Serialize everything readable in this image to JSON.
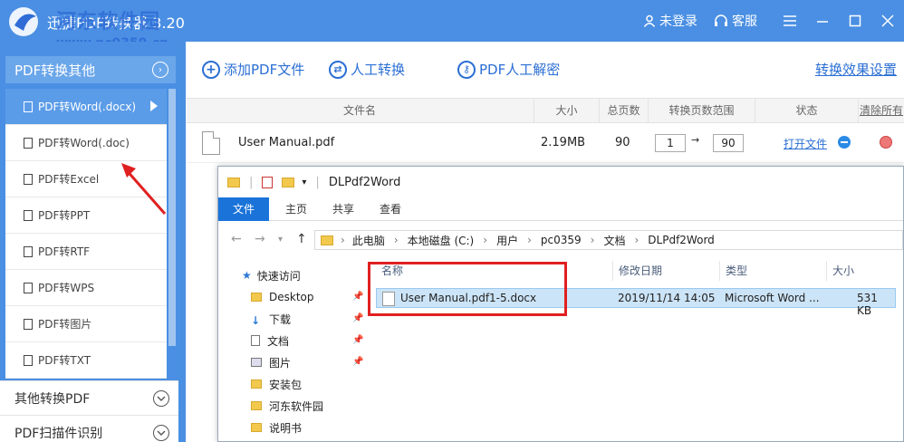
{
  "titlebar": {
    "app_title": "迅捷PDF转换器 3.20",
    "watermark_title": "河东软件园",
    "watermark_url": "www.pc0359.cn",
    "login": "未登录",
    "service": "客服"
  },
  "sidebar": {
    "section_title": "PDF转换其他",
    "items": [
      {
        "label": "PDF转Word(.docx)"
      },
      {
        "label": "PDF转Word(.doc)"
      },
      {
        "label": "PDF转Excel"
      },
      {
        "label": "PDF转PPT"
      },
      {
        "label": "PDF转RTF"
      },
      {
        "label": "PDF转WPS"
      },
      {
        "label": "PDF转图片"
      },
      {
        "label": "PDF转TXT"
      }
    ],
    "other_section": "其他转换PDF",
    "scan_section": "PDF扫描件识别"
  },
  "toolbar": {
    "add_pdf": "添加PDF文件",
    "manual_convert": "人工转换",
    "pdf_decrypt": "PDF人工解密",
    "settings": "转换效果设置"
  },
  "table": {
    "headers": [
      "文件名",
      "大小",
      "总页数",
      "转换页数范围",
      "状态",
      "清除所有"
    ],
    "row": {
      "name": "User Manual.pdf",
      "size": "2.19MB",
      "pages": "90",
      "range_from": "1",
      "range_to": "90",
      "open_file": "打开文件"
    }
  },
  "explorer": {
    "title": "DLPdf2Word",
    "tabs": [
      "文件",
      "主页",
      "共享",
      "查看"
    ],
    "breadcrumb": [
      "此电脑",
      "本地磁盘 (C:)",
      "用户",
      "pc0359",
      "文档",
      "DLPdf2Word"
    ],
    "nav": [
      {
        "label": "快速访问",
        "pinned": false
      },
      {
        "label": "Desktop",
        "pinned": true
      },
      {
        "label": "下载",
        "pinned": true
      },
      {
        "label": "文档",
        "pinned": true
      },
      {
        "label": "图片",
        "pinned": true
      },
      {
        "label": "安装包",
        "pinned": false
      },
      {
        "label": "河东软件园",
        "pinned": false
      },
      {
        "label": "说明书",
        "pinned": false
      }
    ],
    "columns": [
      "名称",
      "修改日期",
      "类型",
      "大小"
    ],
    "file": {
      "name": "User Manual.pdf1-5.docx",
      "date": "2019/11/14 14:05",
      "type": "Microsoft Word ...",
      "size": "531 KB"
    }
  },
  "colors": {
    "accent": "#4a8fe3",
    "link": "#2b6fd4",
    "highlight": "#e02020"
  }
}
